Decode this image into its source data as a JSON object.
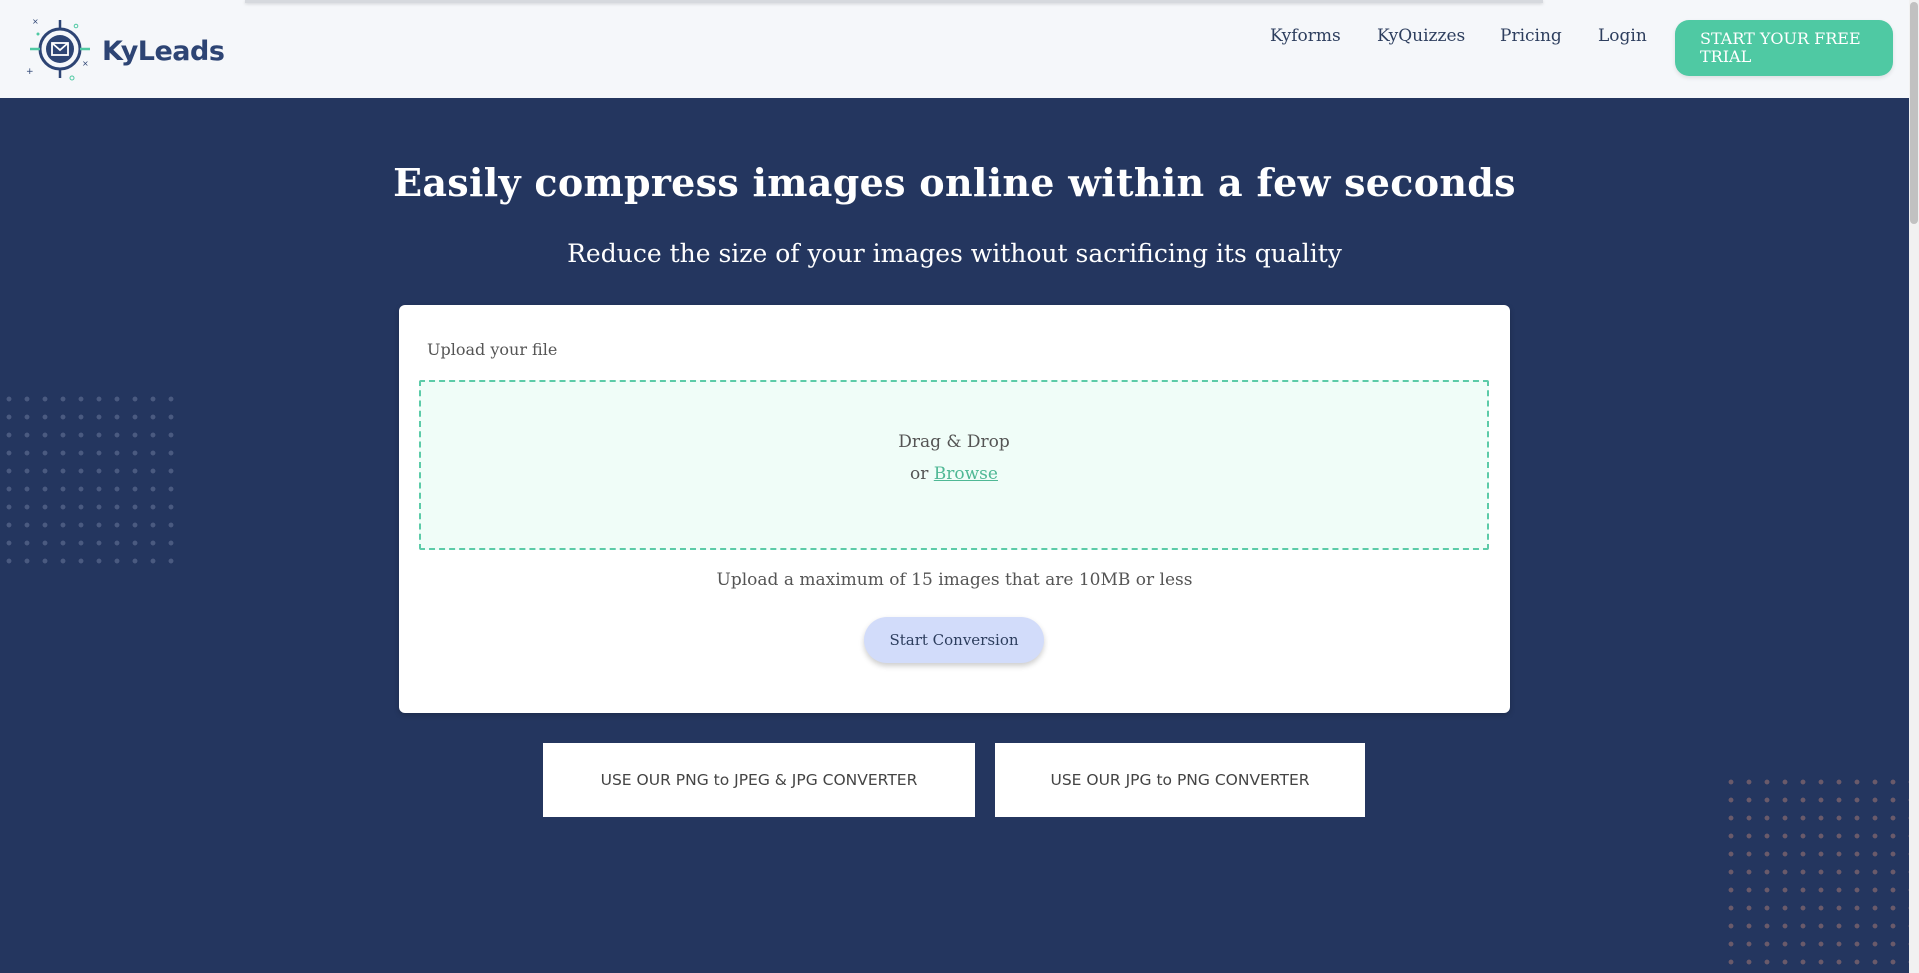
{
  "header": {
    "logo_text": "KyLeads",
    "nav": [
      {
        "label": "Kyforms"
      },
      {
        "label": "KyQuizzes"
      },
      {
        "label": "Pricing"
      },
      {
        "label": "Login"
      }
    ],
    "cta_label": "START YOUR FREE TRIAL"
  },
  "hero": {
    "title": "Easily compress images online within a few seconds",
    "subtitle": "Reduce the size of your images without sacrificing its quality"
  },
  "upload": {
    "label": "Upload your file",
    "drag_text": "Drag & Drop",
    "or_text": "or",
    "browse_label": "Browse",
    "limit_text": "Upload a maximum of 15 images that are 10MB or less",
    "convert_label": "Start Conversion"
  },
  "converters": [
    {
      "label": "USE OUR PNG to JPEG & JPG CONVERTER"
    },
    {
      "label": "USE OUR JPG to PNG CONVERTER"
    }
  ],
  "colors": {
    "background": "#24365f",
    "accent": "#4fc9a3",
    "brand_text": "#2d4474",
    "convert_button": "#d2dcfa"
  },
  "icons": {
    "logo": "envelope-target-icon"
  }
}
